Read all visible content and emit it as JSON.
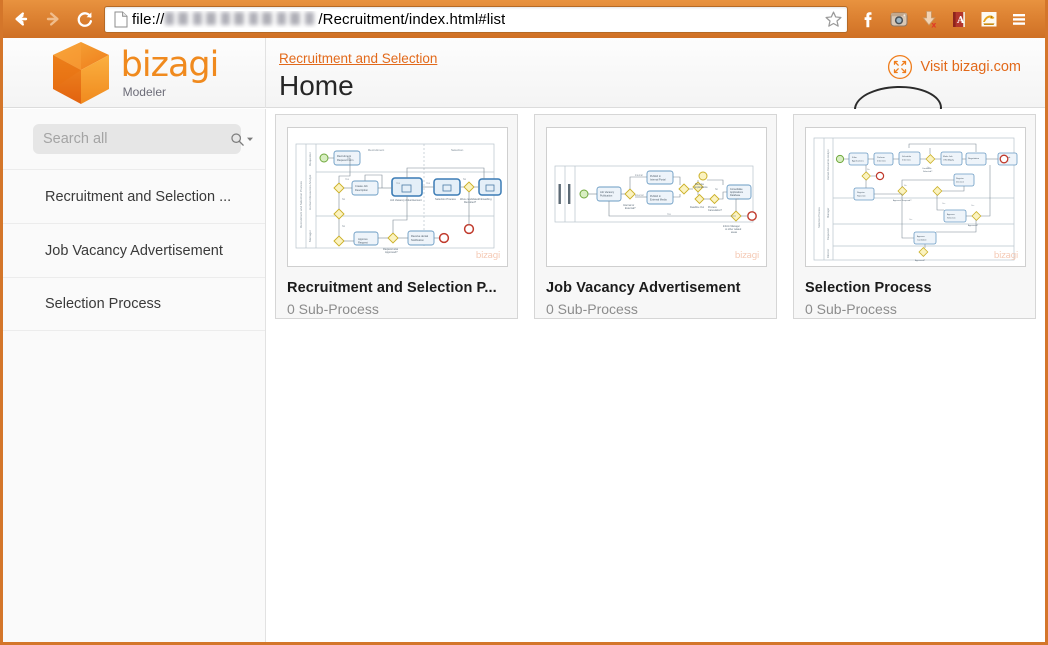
{
  "browser": {
    "back_label": "Back",
    "forward_label": "Forward",
    "reload_label": "Reload",
    "url_prefix": "file://",
    "url_suffix": "/Recruitment/index.html#list",
    "url_redacted": true,
    "bookmark_label": "Bookmark this page",
    "extensions": [
      {
        "name": "facebook-icon",
        "label": "Facebook"
      },
      {
        "name": "instagram-icon",
        "label": "Instagram"
      },
      {
        "name": "download-icon",
        "label": "Downloads"
      },
      {
        "name": "dictionary-icon",
        "label": "Dictionary"
      },
      {
        "name": "frog-icon",
        "label": "Extension"
      },
      {
        "name": "menu-icon",
        "label": "Customize and control"
      }
    ],
    "accent_color": "#dd8232"
  },
  "header": {
    "logo_word": "bizagi",
    "logo_sub": "Modeler",
    "breadcrumb": "Recruitment and Selection",
    "title": "Home",
    "visit_label": "Visit bizagi.com",
    "visit_icon": "expand-icon",
    "brand_orange": "#f08a1e",
    "link_orange": "#e2691a"
  },
  "sidebar": {
    "search": {
      "placeholder": "Search all",
      "value": "",
      "icon": "search-icon",
      "caret": "dropdown-caret-icon"
    },
    "items": [
      {
        "label": "Recruitment and Selection ..."
      },
      {
        "label": "Job Vacancy Advertisement"
      },
      {
        "label": "Selection Process"
      }
    ]
  },
  "main": {
    "cards": [
      {
        "title": "Recruitment and Selection P...",
        "subtitle": "0 Sub-Process",
        "thumb_kind": "bpmn-pool-3-lane",
        "watermark": "bizagi"
      },
      {
        "title": "Job Vacancy Advertisement",
        "subtitle": "0 Sub-Process",
        "thumb_kind": "bpmn-single-lane",
        "watermark": "bizagi"
      },
      {
        "title": "Selection Process",
        "subtitle": "0 Sub-Process",
        "thumb_kind": "bpmn-pool-4-lane",
        "watermark": "bizagi"
      }
    ]
  }
}
